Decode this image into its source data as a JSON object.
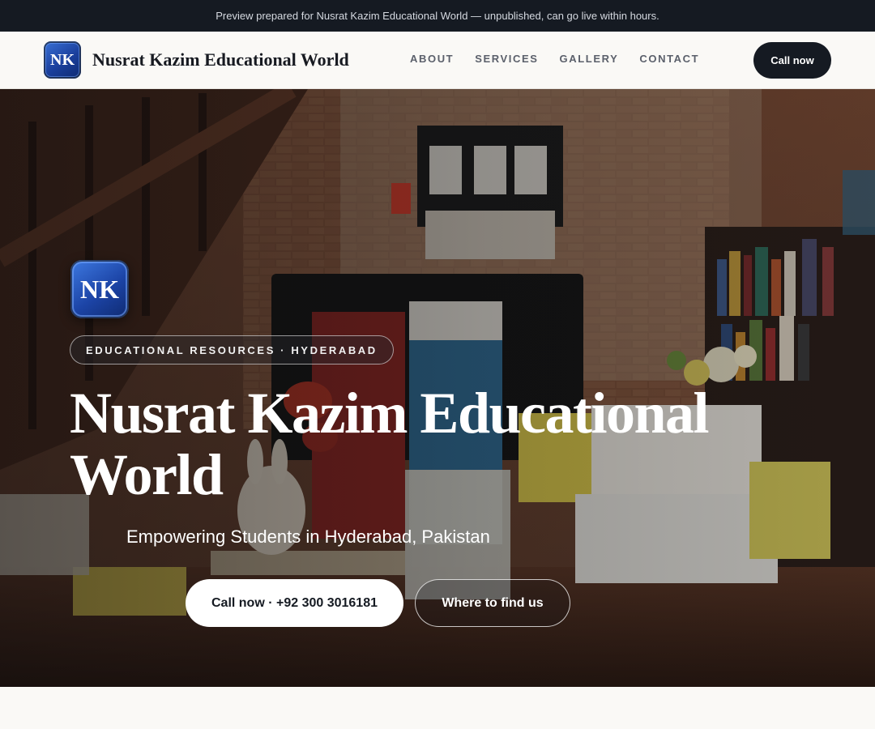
{
  "notice": {
    "text": "Preview prepared for Nusrat Kazim Educational World — unpublished, can go live within hours."
  },
  "header": {
    "logo_initials": "NK",
    "brand_name": "Nusrat Kazim Educational World",
    "nav": [
      "ABOUT",
      "SERVICES",
      "GALLERY",
      "CONTACT"
    ],
    "cta_label": "Call now"
  },
  "hero": {
    "logo_initials": "NK",
    "tag": "EDUCATIONAL RESOURCES · HYDERABAD",
    "title": "Nusrat Kazim Educational World",
    "subtitle": "Empowering Students in Hyderabad, Pakistan",
    "primary_button": "Call now · +92 300 3016181",
    "secondary_button": "Where to find us"
  },
  "colors": {
    "dark": "#151a22",
    "page_bg": "#faf9f6",
    "logo_blue": "#1c44a6"
  }
}
